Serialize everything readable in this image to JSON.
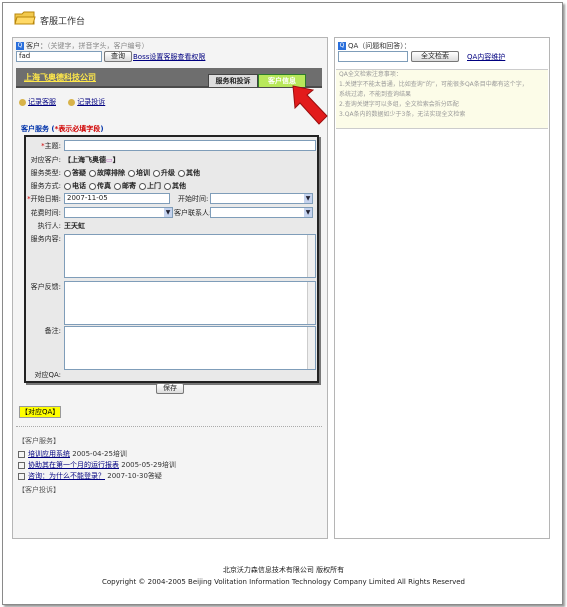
{
  "app": {
    "title": "客服工作台"
  },
  "left_search": {
    "label": "客户：",
    "hint": "（关键字，拼音字头，客户编号）",
    "value": "fad",
    "button": "查询",
    "boss_link": "Boss设置客服查看权限"
  },
  "company": {
    "name": "上海飞奥德科技公司"
  },
  "tabs": [
    {
      "label": "服务和投诉",
      "active": true
    },
    {
      "label": "客户信息",
      "active": false
    }
  ],
  "record_links": [
    "记录客服",
    "记录投诉"
  ],
  "form": {
    "title": "客户服务",
    "required_note": "表示必填字段",
    "fields": {
      "subject_label": "主题:",
      "customer_label": "对应客户:",
      "customer_value": "上海飞奥德",
      "service_type_label": "服务类型:",
      "service_types": [
        "答疑",
        "故障排除",
        "培训",
        "升级",
        "其他"
      ],
      "service_method_label": "服务方式:",
      "service_methods": [
        "电话",
        "传真",
        "邮寄",
        "上门",
        "其他"
      ],
      "start_date_label": "开始日期:",
      "start_date_value": "2007-11-05",
      "start_time_label": "开始时间:",
      "cost_time_label": "花费时间:",
      "contact_label": "客户联系人:",
      "executor_label": "执行人:",
      "executor_value": "王天虹",
      "content_label": "服务内容:",
      "feedback_label": "客户反馈:",
      "remark_label": "备注:",
      "qa_label": "对应QA:"
    },
    "save_button": "保存"
  },
  "qa_tag": "【对应QA】",
  "customer_service_section": {
    "head": "【客户服务】",
    "items": [
      {
        "title": "培训应用系统",
        "date": "2005-04-25",
        "type": "培训"
      },
      {
        "title": "协助其在第一个月的运行报表",
        "date": "2005-05-29",
        "type": "培训"
      },
      {
        "title": "咨询：为什么不能登录？",
        "date": "2007-10-30",
        "type": "答疑"
      }
    ]
  },
  "complaint_section": {
    "head": "【客户投诉】"
  },
  "right_search": {
    "label": "QA（问题和回答）：",
    "button": "全文检索",
    "maintain_link": "QA内容维护",
    "notes": [
      "QA全文检索注意事项：",
      "1.关键字不能太普通，比如查询“的”，可能很多QA条目中都有这个字，",
      "系统过滤，不能到查询结果",
      "2.查询关键字可以多组，全文检索会拆分匹配",
      "3.QA条内的数据如少于3条，无法实现全文检索"
    ]
  },
  "footer": {
    "company": "北京沃力森信息技术有限公司  版权所有",
    "copyright": "Copyright © 2004-2005 Beijing Volitation Information Technology Company Limited All Rights Reserved"
  },
  "colors": {
    "company_bar": "#6e6e6e",
    "company_name": "#ffe84a",
    "active_tab": "#b8e85a",
    "arrow": "#e21b1b",
    "qa_tag_bg": "#ffff00"
  }
}
